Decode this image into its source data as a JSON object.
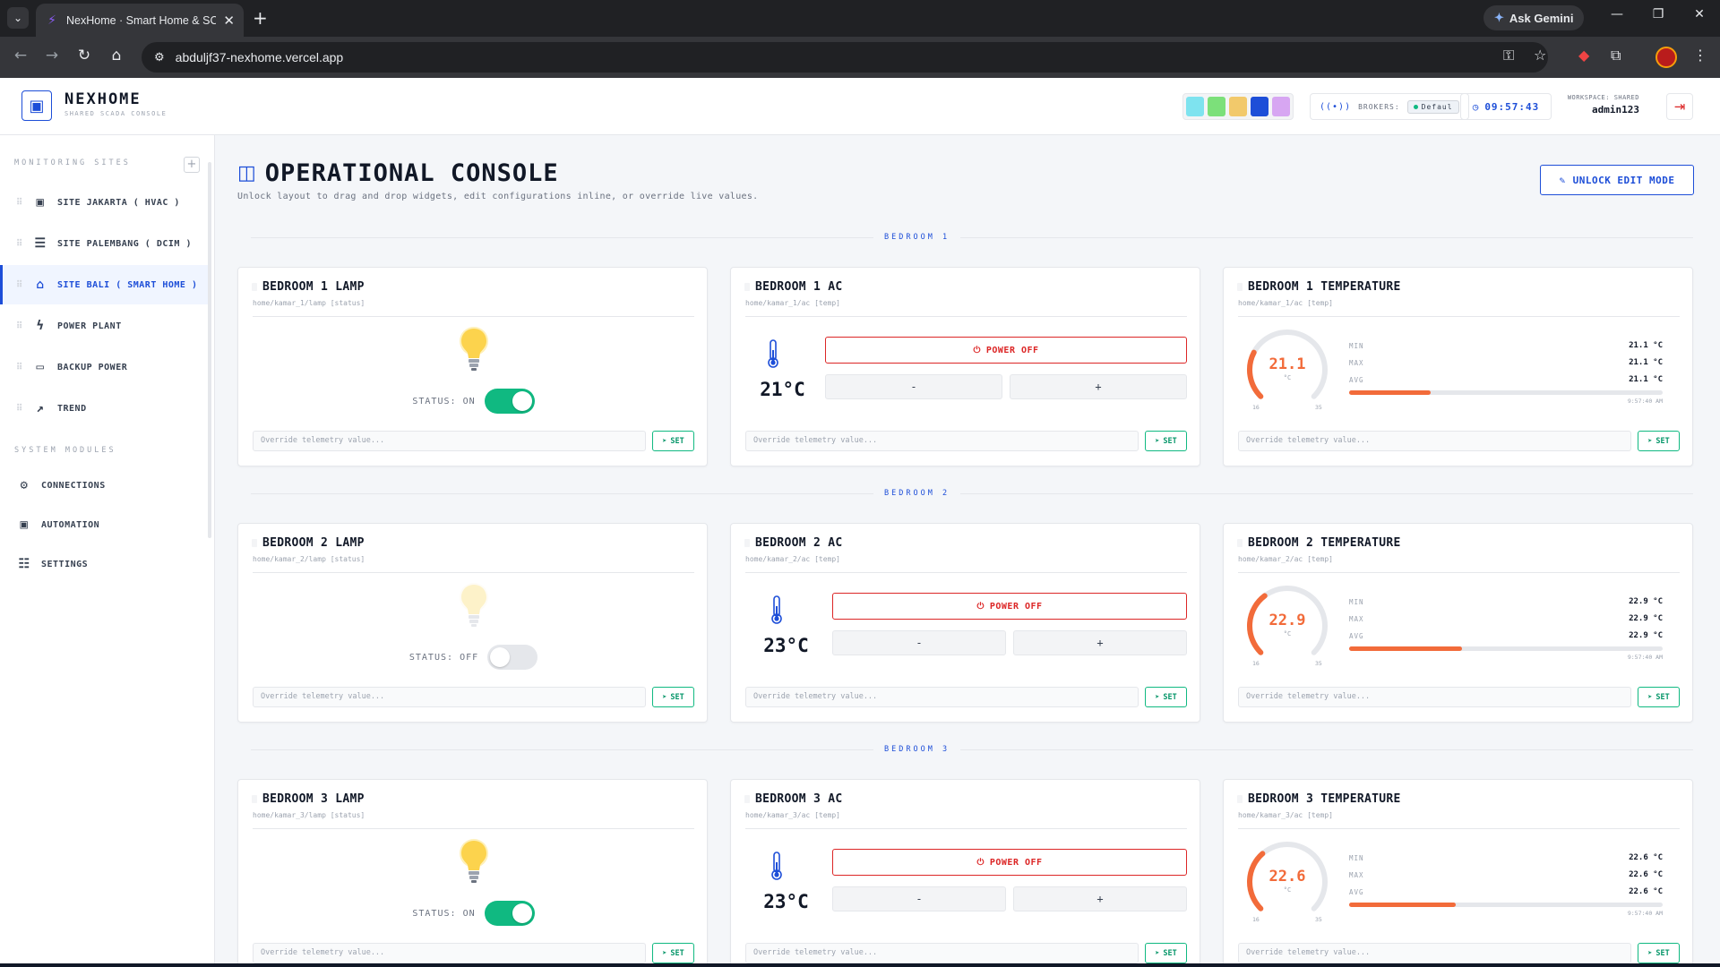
{
  "browser": {
    "tab_title": "NexHome · Smart Home & SCADA",
    "url": "abduljf37-nexhome.vercel.app",
    "gemini_label": "Ask Gemini"
  },
  "header": {
    "brand": "NEXHOME",
    "subtitle": "SHARED SCADA CONSOLE",
    "theme_swatches": [
      "#7ee3ef",
      "#7ce07a",
      "#f2c96b",
      "#1d4ed8",
      "#d7a6f2"
    ],
    "brokers_label": "BROKERS:",
    "broker_name": "Defaul",
    "clock": "09:57:43",
    "workspace_label": "WORKSPACE: SHARED",
    "user": "admin123"
  },
  "sidebar": {
    "sites_heading": "MONITORING SITES",
    "sites": [
      {
        "label": "SITE JAKARTA ( HVAC )",
        "icon": "cpu-icon",
        "active": false
      },
      {
        "label": "SITE PALEMBANG ( DCIM )",
        "icon": "server-icon",
        "active": false
      },
      {
        "label": "SITE BALI ( SMART HOME )",
        "icon": "home-icon",
        "active": true
      },
      {
        "label": "POWER PLANT",
        "icon": "zap-icon",
        "active": false
      },
      {
        "label": "BACKUP POWER",
        "icon": "battery-icon",
        "active": false
      },
      {
        "label": "TREND",
        "icon": "trend-icon",
        "active": false
      }
    ],
    "modules_heading": "SYSTEM MODULES",
    "modules": [
      {
        "label": "CONNECTIONS",
        "icon": "gear-icon"
      },
      {
        "label": "AUTOMATION",
        "icon": "cpu-icon"
      },
      {
        "label": "SETTINGS",
        "icon": "sliders-icon"
      }
    ]
  },
  "main": {
    "title": "OPERATIONAL CONSOLE",
    "description": "Unlock layout to drag and drop widgets, edit configurations inline, or override live values.",
    "unlock_label": "UNLOCK EDIT MODE",
    "override_placeholder": "Override telemetry value...",
    "set_label": "SET",
    "power_label": "POWER OFF",
    "minus_label": "-",
    "plus_label": "+",
    "status_prefix": "STATUS:",
    "stat_labels": [
      "MIN",
      "MAX",
      "AVG"
    ],
    "gauge_unit": "°C",
    "gauge_min": "16",
    "gauge_max": "35",
    "sections": [
      {
        "label": "BEDROOM 1",
        "lamp": {
          "title": "BEDROOM 1 LAMP",
          "topic": "home/kamar_1/lamp [status]",
          "status": "ON",
          "on": true
        },
        "ac": {
          "title": "BEDROOM 1 AC",
          "topic": "home/kamar_1/ac [temp]",
          "temp": "21°C"
        },
        "temp": {
          "title": "BEDROOM 1 TEMPERATURE",
          "topic": "home/kamar_1/ac [temp]",
          "value": "21.1",
          "min": "21.1 °C",
          "max": "21.1 °C",
          "avg": "21.1 °C",
          "time": "9:57:40 AM",
          "bar_fraction": 0.26
        }
      },
      {
        "label": "BEDROOM 2",
        "lamp": {
          "title": "BEDROOM 2 LAMP",
          "topic": "home/kamar_2/lamp [status]",
          "status": "OFF",
          "on": false
        },
        "ac": {
          "title": "BEDROOM 2 AC",
          "topic": "home/kamar_2/ac [temp]",
          "temp": "23°C"
        },
        "temp": {
          "title": "BEDROOM 2 TEMPERATURE",
          "topic": "home/kamar_2/ac [temp]",
          "value": "22.9",
          "min": "22.9 °C",
          "max": "22.9 °C",
          "avg": "22.9 °C",
          "time": "9:57:40 AM",
          "bar_fraction": 0.36
        }
      },
      {
        "label": "BEDROOM 3",
        "lamp": {
          "title": "BEDROOM 3 LAMP",
          "topic": "home/kamar_3/lamp [status]",
          "status": "ON",
          "on": true
        },
        "ac": {
          "title": "BEDROOM 3 AC",
          "topic": "home/kamar_3/ac [temp]",
          "temp": "23°C"
        },
        "temp": {
          "title": "BEDROOM 3 TEMPERATURE",
          "topic": "home/kamar_3/ac [temp]",
          "value": "22.6",
          "min": "22.6 °C",
          "max": "22.6 °C",
          "avg": "22.6 °C",
          "time": "9:57:40 AM",
          "bar_fraction": 0.34
        }
      }
    ]
  }
}
